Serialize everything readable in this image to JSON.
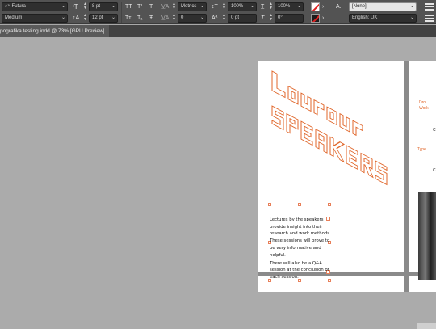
{
  "control_panel": {
    "font_family": "Futura",
    "font_style": "Medium",
    "font_size": "8 pt",
    "leading": "12 pt",
    "kerning": "Metrics",
    "tracking": "0",
    "vertical_scale": "100%",
    "horizontal_scale": "100%",
    "baseline_shift": "0 pt",
    "skew": "0°",
    "character_style": "[None]",
    "language": "English: UK",
    "tt_label": "TT",
    "tt_superscript_label": "T¹",
    "t_underline_label": "T",
    "tt_small_label": "Tт",
    "t_subscript_label": "T₁",
    "t_strike_label": "Ŧ",
    "char_style_icon_label": "A.",
    "skew_icon_label": "T"
  },
  "document_tab": {
    "title": "pografika testing.indd @ 73% [GPU Preview]"
  },
  "layout_page": {
    "body_paragraphs": [
      "Lectures by the speakers provide insight into their research and work methods. These sessions will prove to be very informative and helpful.",
      "There will also be a Q&A session at the conclusion of each session."
    ]
  },
  "colors": {
    "accent": "#e0662a",
    "panel": "#535353",
    "pasteboard": "#ababab",
    "selection": "#e8805a"
  }
}
